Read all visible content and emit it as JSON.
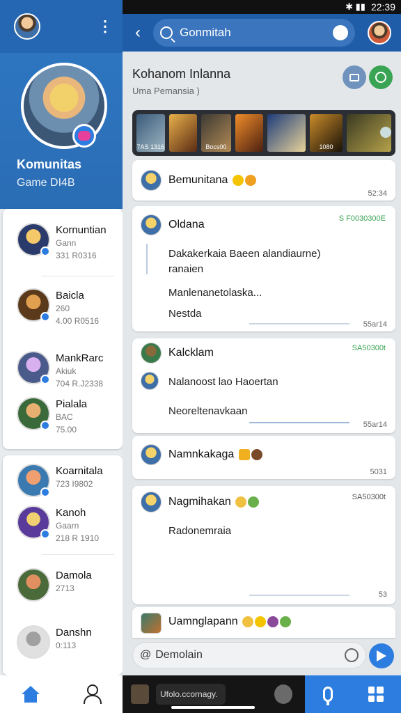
{
  "status": {
    "time": "22:39"
  },
  "left": {
    "title": "Komunitas",
    "subtitle": "Game DI4B",
    "friends_top": [
      {
        "name": "Kornuntian",
        "sub": "Gann",
        "meta": "331 R0316"
      },
      {
        "name": "Baicla",
        "sub": "260",
        "meta": "4.00 R0516"
      },
      {
        "name": "MankRarc",
        "sub": "Akiuk",
        "meta": "704 R.J2338"
      },
      {
        "name": "Pialala",
        "sub": "BAC",
        "meta": "75.00"
      }
    ],
    "friends_bottom": [
      {
        "name": "Koarnitala",
        "sub": "723 I9802",
        "meta": ""
      },
      {
        "name": "Kanoh",
        "sub": "Gaarn",
        "meta": "218 R 1910"
      },
      {
        "name": "Damola",
        "sub": "2713",
        "meta": ""
      },
      {
        "name": "Danshn",
        "sub": "0:113",
        "meta": ""
      }
    ]
  },
  "topbar": {
    "search_label": "Gonmitah"
  },
  "community": {
    "title": "Kohanom Inlanna",
    "subtitle": "Uma Pemansia )"
  },
  "gallery": {
    "captions": [
      "7AS 1316",
      "",
      "Bocs00",
      "",
      "",
      "1080",
      ""
    ]
  },
  "messages": [
    {
      "name": "Bemunitana",
      "time": "52:34",
      "lines": []
    },
    {
      "name": "Oldana",
      "tag": "S F0030300E",
      "time": "55ar14",
      "lines": [
        "Dakakerkaia Baeen alandiaurne)",
        "ranaien",
        "Manlenanetolaska...",
        "Nestda"
      ]
    },
    {
      "name": "Kalcklam",
      "tag": "SA50300t",
      "time": "55ar14",
      "lines": [
        "Nalanoost lao Haoertan",
        "Neoreltenavkaan"
      ]
    },
    {
      "name": "Namnkakaga",
      "time": "5031",
      "lines": []
    },
    {
      "name": "Nagmihakan",
      "tag": "SA50300t",
      "time": "53",
      "lines": [
        "Radonemraia"
      ]
    },
    {
      "name": "Uamnglapann",
      "time": "",
      "lines": []
    }
  ],
  "composer": {
    "placeholder": "Demolain"
  },
  "bottom": {
    "mid_label": "Ufolo.ccornagy."
  },
  "colors": {
    "primary": "#2d7de0",
    "header": "#1f5da8",
    "accent_green": "#3aa455"
  }
}
